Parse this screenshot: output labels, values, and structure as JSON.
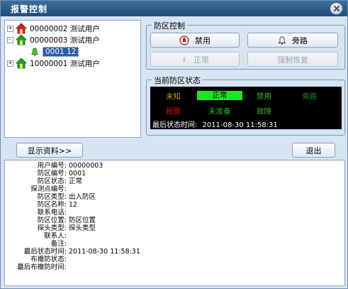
{
  "window": {
    "title": "报警控制"
  },
  "tree": {
    "nodes": [
      {
        "expander": "+",
        "label": "00000002  测试用户",
        "house": "#d22020"
      },
      {
        "expander": "-",
        "label": "00000003  测试用户",
        "house": "#1ea61e"
      },
      {
        "child": true,
        "label": "0001  12",
        "selected": true
      },
      {
        "expander": "+",
        "label": "10000001  测试用户",
        "house": "#1ea61e"
      }
    ]
  },
  "zone_control": {
    "title": "防区控制",
    "buttons": {
      "disarm": "禁用",
      "bypass": "旁路",
      "normal": "正常",
      "force_restore": "强制恢复"
    }
  },
  "zone_status": {
    "title": "当前防区状态",
    "labels": {
      "unknown": "未知",
      "normal": "正常",
      "disabled": "禁用",
      "bypassed": "旁路",
      "alarm": "报警",
      "not_ready": "未准备",
      "fault": "故障"
    },
    "colors": {
      "unknown": "#c8a000",
      "normal_bg": "#1fe51f",
      "disabled": "#2fc22f",
      "bypassed": "#1c8e1c",
      "alarm": "#cc1010",
      "not_ready": "#2fb52f",
      "fault": "#2fb52f"
    },
    "last_time_label": "最后状态时间:",
    "last_time_value": "2011-08-30 11:58:31"
  },
  "actions": {
    "show_info": "显示资料>>",
    "exit": "退出"
  },
  "info": [
    {
      "label": "用户编号:",
      "value": "00000003"
    },
    {
      "label": "防区编号:",
      "value": "0001"
    },
    {
      "label": "防区状态:",
      "value": "正常"
    },
    {
      "label": "探测点编号:",
      "value": ""
    },
    {
      "label": "防区类型:",
      "value": "出入防区"
    },
    {
      "label": "防区名称:",
      "value": "12"
    },
    {
      "label": "联系电话:",
      "value": ""
    },
    {
      "label": "防区位置:",
      "value": "防区位置"
    },
    {
      "label": "探头类型:",
      "value": "探头类型"
    },
    {
      "label": "联系人:",
      "value": ""
    },
    {
      "label": "备注:",
      "value": ""
    },
    {
      "label": "最后状态时间:",
      "value": "2011-08-30 11:58:31"
    },
    {
      "label": "布撤防状态:",
      "value": ""
    },
    {
      "label": "最后布撤防时间:",
      "value": ""
    }
  ]
}
